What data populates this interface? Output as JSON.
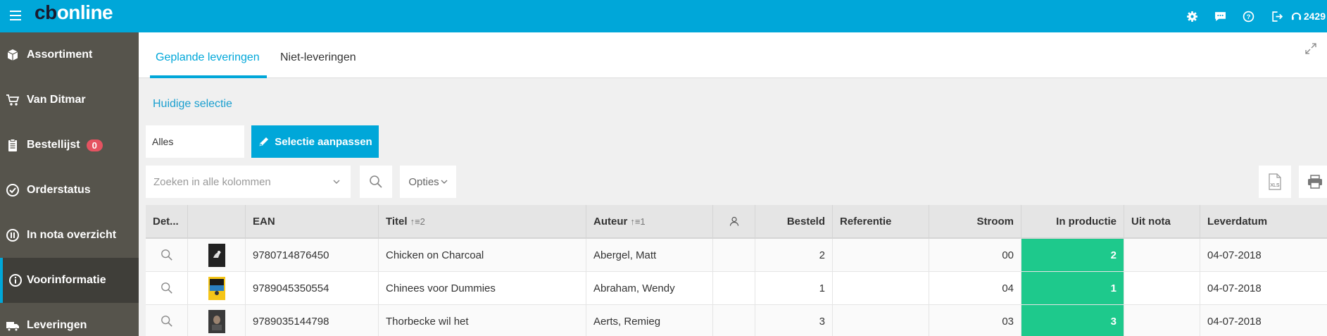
{
  "app": {
    "logo_prefix": "cb",
    "logo_suffix": "online",
    "phone": "2429"
  },
  "colors": {
    "brand": "#00a7d9",
    "sidebar": "#56544c",
    "sidebar_active": "#3f3e39",
    "badge": "#e55361",
    "in_production": "#1ec98c"
  },
  "topbar_icons": [
    "gear-icon",
    "chat-icon",
    "help-icon",
    "logout-icon",
    "headset-icon"
  ],
  "sidebar": {
    "items": [
      {
        "label": "Assortiment",
        "icon": "box-icon"
      },
      {
        "label": "Van Ditmar",
        "icon": "cart-icon"
      },
      {
        "label": "Bestellijst",
        "icon": "clipboard-icon",
        "badge": "0"
      },
      {
        "label": "Orderstatus",
        "icon": "check-circle-icon"
      },
      {
        "label": "In nota overzicht",
        "icon": "pause-circle-icon"
      },
      {
        "label": "Voorinformatie",
        "icon": "info-circle-icon",
        "active": true
      },
      {
        "label": "Leveringen",
        "icon": "truck-icon"
      }
    ]
  },
  "tabs": [
    {
      "label": "Geplande leveringen",
      "active": true
    },
    {
      "label": "Niet-leveringen",
      "active": false
    }
  ],
  "selection": {
    "title": "Huidige selectie",
    "value": "Alles",
    "button_label": "Selectie aanpassen"
  },
  "toolbar": {
    "search_placeholder": "Zoeken in alle kolommen",
    "options_label": "Opties",
    "xls_label": "XLS"
  },
  "table": {
    "columns": [
      {
        "label": "Det..."
      },
      {
        "label": ""
      },
      {
        "label": "EAN"
      },
      {
        "label": "Titel",
        "sort": "↑≡2"
      },
      {
        "label": "Auteur",
        "sort": "↑≡1"
      },
      {
        "label": "",
        "icon": "person-icon"
      },
      {
        "label": "Besteld"
      },
      {
        "label": "Referentie"
      },
      {
        "label": "Stroom"
      },
      {
        "label": "In productie"
      },
      {
        "label": "Uit nota"
      },
      {
        "label": "Leverdatum"
      }
    ],
    "rows": [
      {
        "ean": "9780714876450",
        "titel": "Chicken on Charcoal",
        "auteur": "Abergel, Matt",
        "besteld": "2",
        "referentie": "",
        "stroom": "00",
        "in_productie": "2",
        "uit_nota": "",
        "leverdatum": "04-07-2018"
      },
      {
        "ean": "9789045350554",
        "titel": "Chinees voor Dummies",
        "auteur": "Abraham, Wendy",
        "besteld": "1",
        "referentie": "",
        "stroom": "04",
        "in_productie": "1",
        "uit_nota": "",
        "leverdatum": "04-07-2018"
      },
      {
        "ean": "9789035144798",
        "titel": "Thorbecke wil het",
        "auteur": "Aerts, Remieg",
        "besteld": "3",
        "referentie": "",
        "stroom": "03",
        "in_productie": "3",
        "uit_nota": "",
        "leverdatum": "04-07-2018"
      }
    ]
  }
}
